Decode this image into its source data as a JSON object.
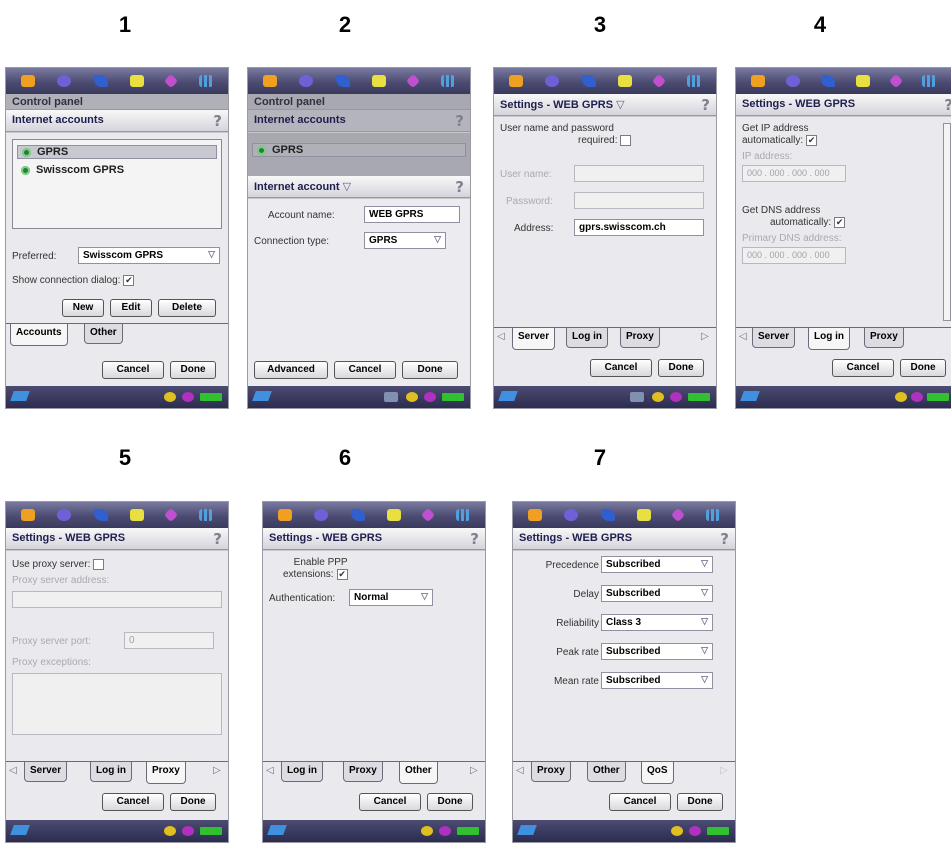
{
  "numbers": [
    "1",
    "2",
    "3",
    "4",
    "5",
    "6",
    "7"
  ],
  "s1": {
    "title": "Internet accounts",
    "back_title": "Control panel",
    "accounts": [
      "GPRS",
      "Swisscom GPRS"
    ],
    "preferred_label": "Preferred:",
    "preferred_value": "Swisscom GPRS",
    "show_dialog_label": "Show connection dialog:",
    "show_dialog_checked": "✔",
    "btn_new": "New",
    "btn_edit": "Edit",
    "btn_delete": "Delete",
    "tab_accounts": "Accounts",
    "tab_other": "Other",
    "cancel": "Cancel",
    "done": "Done"
  },
  "s2": {
    "back_title_1": "Control panel",
    "back_title_2": "Internet accounts",
    "back_item": "GPRS",
    "title": "Internet account",
    "title_arrow": "▽",
    "account_name_label": "Account name:",
    "account_name_value": "WEB GPRS",
    "conn_type_label": "Connection type:",
    "conn_type_value": "GPRS",
    "advanced": "Advanced",
    "cancel": "Cancel",
    "done": "Done"
  },
  "s3": {
    "title": "Settings - WEB GPRS",
    "title_arrow": "▽",
    "up_required_1": "User name and password",
    "up_required_2": "required:",
    "user_name_label": "User name:",
    "password_label": "Password:",
    "address_label": "Address:",
    "address_value": "gprs.swisscom.ch",
    "tab_server": "Server",
    "tab_login": "Log in",
    "tab_proxy": "Proxy",
    "cancel": "Cancel",
    "done": "Done"
  },
  "s4": {
    "title": "Settings - WEB GPRS",
    "get_ip_1": "Get IP address",
    "get_ip_2": "automatically:",
    "ip_label": "IP address:",
    "ip_value": "000 . 000 . 000 . 000",
    "get_dns_1": "Get DNS address",
    "get_dns_2": "automatically:",
    "primary_dns_label": "Primary DNS address:",
    "dns_value": "000 . 000 . 000 . 000",
    "checked": "✔",
    "tab_server": "Server",
    "tab_login": "Log in",
    "tab_proxy": "Proxy",
    "cancel": "Cancel",
    "done": "Done"
  },
  "s5": {
    "title": "Settings - WEB GPRS",
    "use_proxy": "Use proxy server:",
    "proxy_addr_label": "Proxy server address:",
    "proxy_port_label": "Proxy server port:",
    "proxy_port_value": "0",
    "proxy_exceptions_label": "Proxy exceptions:",
    "tab_server": "Server",
    "tab_login": "Log in",
    "tab_proxy": "Proxy",
    "cancel": "Cancel",
    "done": "Done"
  },
  "s6": {
    "title": "Settings - WEB GPRS",
    "enable_ppp_1": "Enable PPP",
    "enable_ppp_2": "extensions:",
    "checked": "✔",
    "auth_label": "Authentication:",
    "auth_value": "Normal",
    "tab_login": "Log in",
    "tab_proxy": "Proxy",
    "tab_other": "Other",
    "cancel": "Cancel",
    "done": "Done"
  },
  "s7": {
    "title": "Settings - WEB GPRS",
    "rows": [
      {
        "label": "Precedence",
        "value": "Subscribed"
      },
      {
        "label": "Delay",
        "value": "Subscribed"
      },
      {
        "label": "Reliability",
        "value": "Class 3"
      },
      {
        "label": "Peak rate",
        "value": "Subscribed"
      },
      {
        "label": "Mean rate",
        "value": "Subscribed"
      }
    ],
    "tab_proxy": "Proxy",
    "tab_other": "Other",
    "tab_qos": "QoS",
    "cancel": "Cancel",
    "done": "Done"
  },
  "glyphs": {
    "help": "?",
    "arrow_down": "▽",
    "tab_left": "◁",
    "tab_right": "▷"
  }
}
